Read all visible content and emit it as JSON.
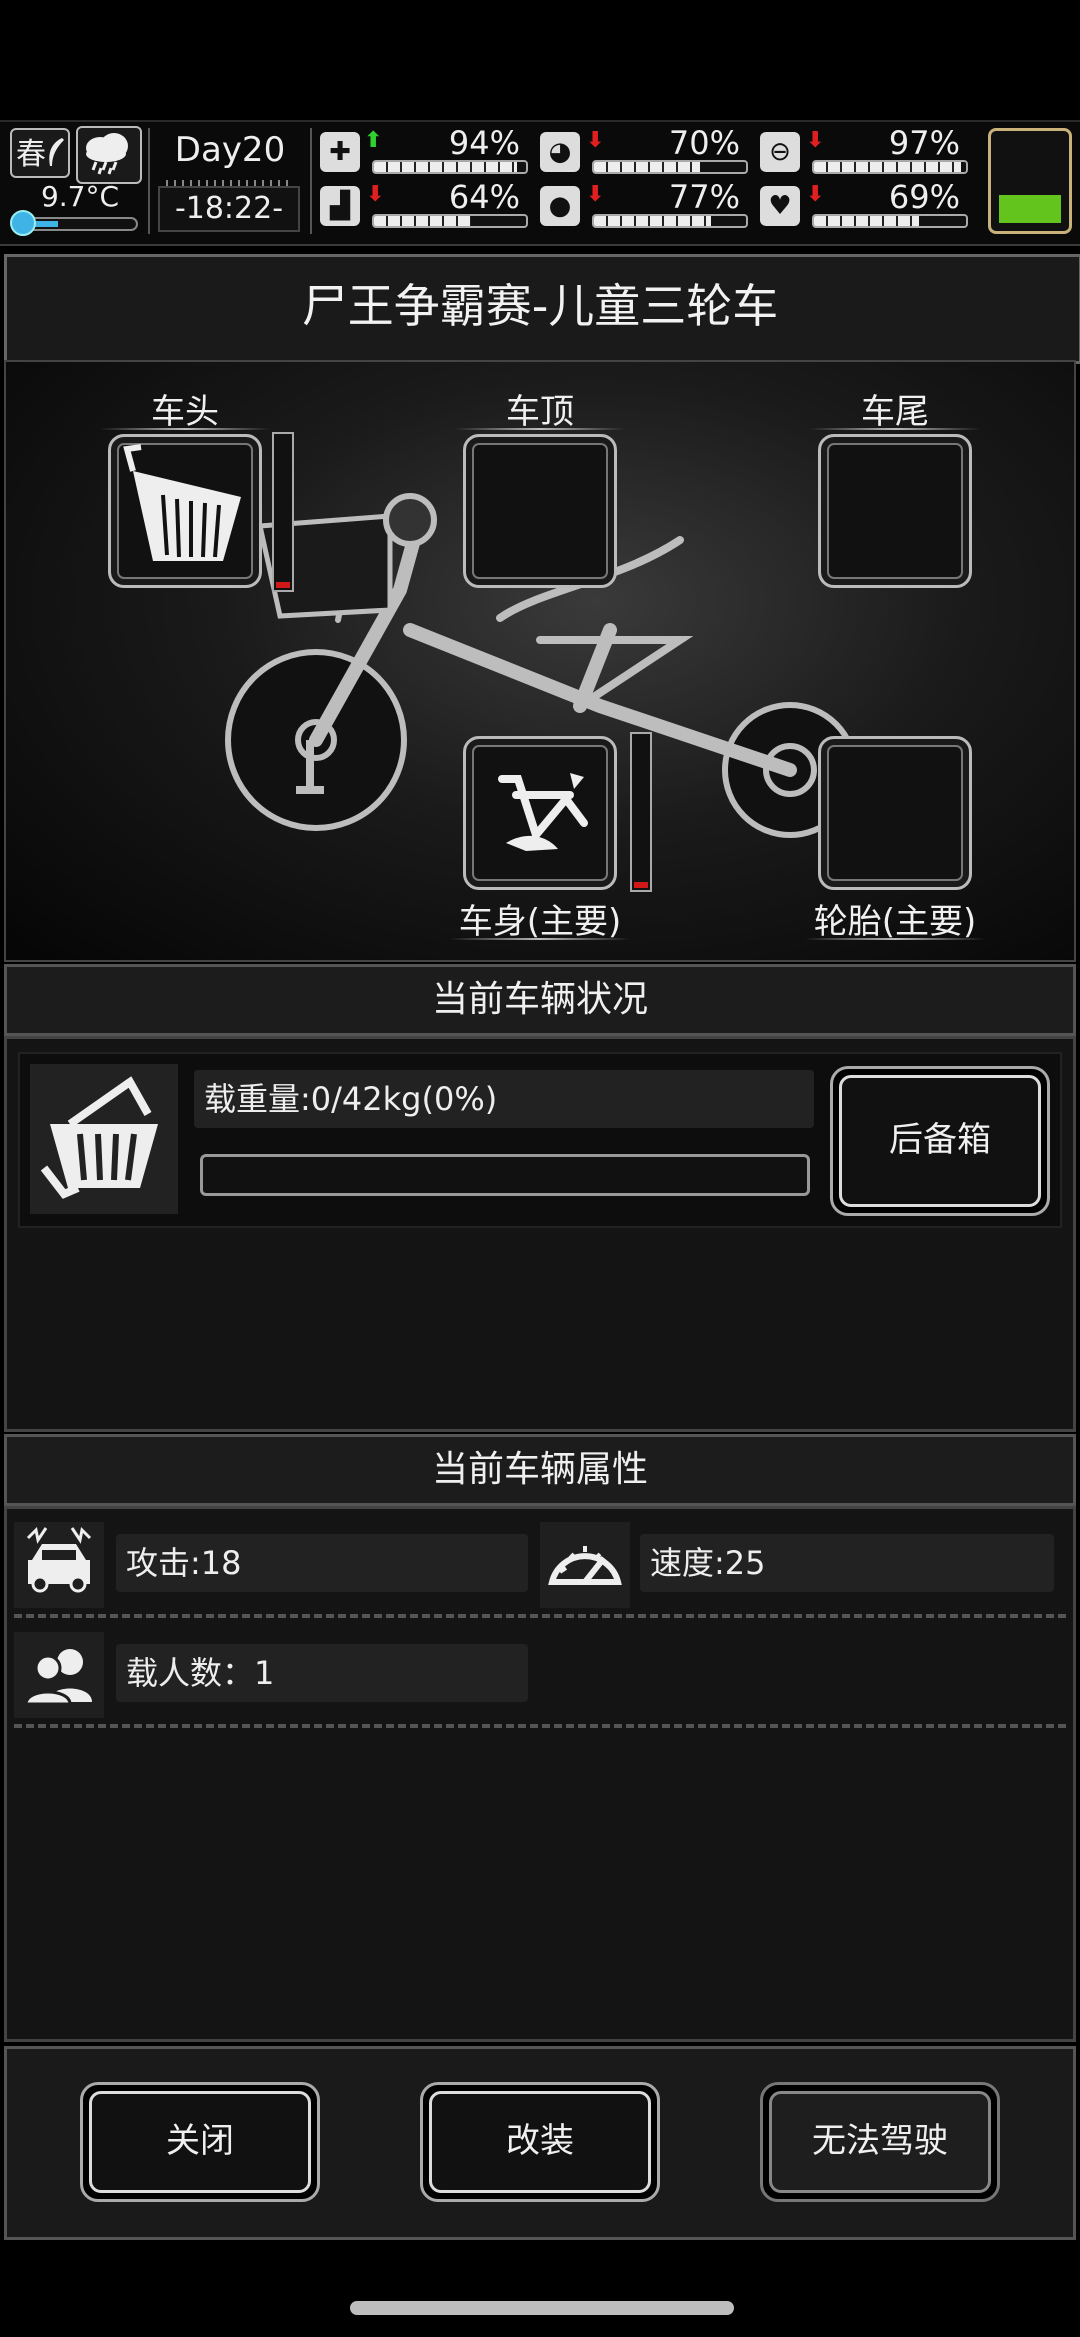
{
  "status": {
    "season": "春",
    "temperature": "9.7°C",
    "day": "Day20",
    "time": "-18:22-",
    "stats": [
      {
        "icon": "medkit-icon",
        "trend": "up",
        "value": "94%",
        "fill": 0.94
      },
      {
        "icon": "stomach-icon",
        "trend": "down",
        "value": "70%",
        "fill": 0.7
      },
      {
        "icon": "bladder-icon",
        "trend": "down",
        "value": "97%",
        "fill": 0.97
      },
      {
        "icon": "boot-icon",
        "trend": "down",
        "value": "64%",
        "fill": 0.64
      },
      {
        "icon": "water-drop-icon",
        "trend": "down",
        "value": "77%",
        "fill": 0.77
      },
      {
        "icon": "heart-icon",
        "trend": "down",
        "value": "69%",
        "fill": 0.69
      }
    ],
    "battery_level": 0.35
  },
  "title": "尸王争霸赛-儿童三轮车",
  "slots": {
    "head": "车头",
    "roof": "车顶",
    "tail": "车尾",
    "body": "车身(主要)",
    "tire": "轮胎(主要)"
  },
  "condition": {
    "heading": "当前车辆状况",
    "load_label": "载重量:0/42kg(0%)",
    "load_fill": 0,
    "trunk_button": "后备箱"
  },
  "attributes": {
    "heading": "当前车辆属性",
    "attack": "攻击:18",
    "speed": "速度:25",
    "passengers": "载人数：1"
  },
  "buttons": {
    "close": "关闭",
    "modify": "改装",
    "drive": "无法驾驶"
  }
}
